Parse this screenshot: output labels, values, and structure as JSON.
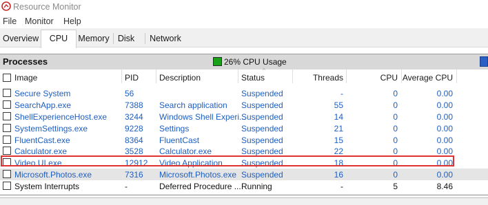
{
  "window": {
    "title": "Resource Monitor"
  },
  "menu": [
    {
      "label": "File"
    },
    {
      "label": "Monitor"
    },
    {
      "label": "Help"
    }
  ],
  "tabs": [
    {
      "label": "Overview",
      "active": false
    },
    {
      "label": "CPU",
      "active": true
    },
    {
      "label": "Memory",
      "active": false
    },
    {
      "label": "Disk",
      "active": false
    },
    {
      "label": "Network",
      "active": false
    }
  ],
  "processes": {
    "title": "Processes",
    "cpu_usage": "26% CPU Usage",
    "indicator_color": "#1aa11a",
    "columns": {
      "image": "Image",
      "pid": "PID",
      "description": "Description",
      "status": "Status",
      "threads": "Threads",
      "cpu": "CPU",
      "avg_cpu": "Average CPU"
    },
    "rows": [
      {
        "image": "Secure System",
        "pid": "56",
        "description": "",
        "status": "Suspended",
        "threads": "-",
        "cpu": "0",
        "avg_cpu": "0.00"
      },
      {
        "image": "SearchApp.exe",
        "pid": "7388",
        "description": "Search application",
        "status": "Suspended",
        "threads": "55",
        "cpu": "0",
        "avg_cpu": "0.00"
      },
      {
        "image": "ShellExperienceHost.exe",
        "pid": "3244",
        "description": "Windows Shell Experi...",
        "status": "Suspended",
        "threads": "14",
        "cpu": "0",
        "avg_cpu": "0.00"
      },
      {
        "image": "SystemSettings.exe",
        "pid": "9228",
        "description": "Settings",
        "status": "Suspended",
        "threads": "21",
        "cpu": "0",
        "avg_cpu": "0.00"
      },
      {
        "image": "FluentCast.exe",
        "pid": "8364",
        "description": "FluentCast",
        "status": "Suspended",
        "threads": "15",
        "cpu": "0",
        "avg_cpu": "0.00"
      },
      {
        "image": "Calculator.exe",
        "pid": "3528",
        "description": "Calculator.exe",
        "status": "Suspended",
        "threads": "22",
        "cpu": "0",
        "avg_cpu": "0.00"
      },
      {
        "image": "Video.UI.exe",
        "pid": "12912",
        "description": "Video Application",
        "status": "Suspended",
        "threads": "18",
        "cpu": "0",
        "avg_cpu": "0.00"
      },
      {
        "image": "Microsoft.Photos.exe",
        "pid": "7316",
        "description": "Microsoft.Photos.exe",
        "status": "Suspended",
        "threads": "16",
        "cpu": "0",
        "avg_cpu": "0.00"
      },
      {
        "image": "System Interrupts",
        "pid": "-",
        "description": "Deferred Procedure ...",
        "status": "Running",
        "threads": "-",
        "cpu": "5",
        "avg_cpu": "8.46"
      }
    ]
  }
}
